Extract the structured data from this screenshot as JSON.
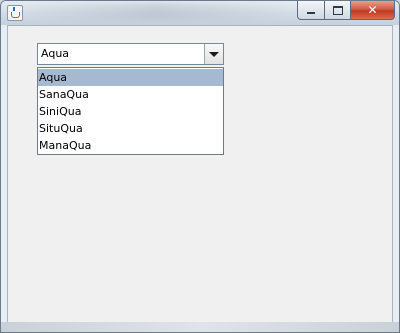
{
  "window": {
    "title_icon": "java-cup-icon",
    "buttons": {
      "minimize_icon": "minimize-icon",
      "maximize_icon": "maximize-icon",
      "close_icon": "close-icon",
      "close_glyph": "✕"
    }
  },
  "combo": {
    "selected_value": "Aqua",
    "arrow_icon": "chevron-down-icon",
    "expanded": true,
    "options": [
      "Aqua",
      "SanaQua",
      "SiniQua",
      "SituQua",
      "ManaQua"
    ],
    "highlighted_index": 0
  },
  "colors": {
    "selection": "#a7b9d0",
    "close_button": "#c1381f"
  }
}
